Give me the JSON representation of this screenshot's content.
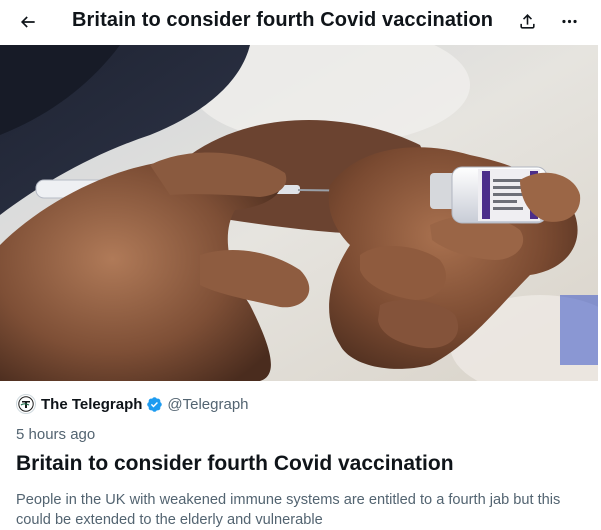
{
  "header": {
    "title": "Britain to consider fourth Covid vaccination",
    "back_icon": "arrow-left-icon",
    "share_icon": "share-icon",
    "more_icon": "ellipsis-icon"
  },
  "hero_image": {
    "subject": "hands-filling-syringe-from-vaccine-vial-icon"
  },
  "card": {
    "source_name": "The Telegraph",
    "source_handle": "@Telegraph",
    "verified": true,
    "time_ago": "5 hours ago",
    "headline": "Britain to consider fourth Covid vaccination",
    "summary": "People in the UK with weakened immune systems are entitled to a fourth jab but this could be extended to the elderly and vulnerable"
  },
  "colors": {
    "text_primary": "#0f1419",
    "text_secondary": "#536471",
    "verified_blue": "#1d9bf0"
  }
}
